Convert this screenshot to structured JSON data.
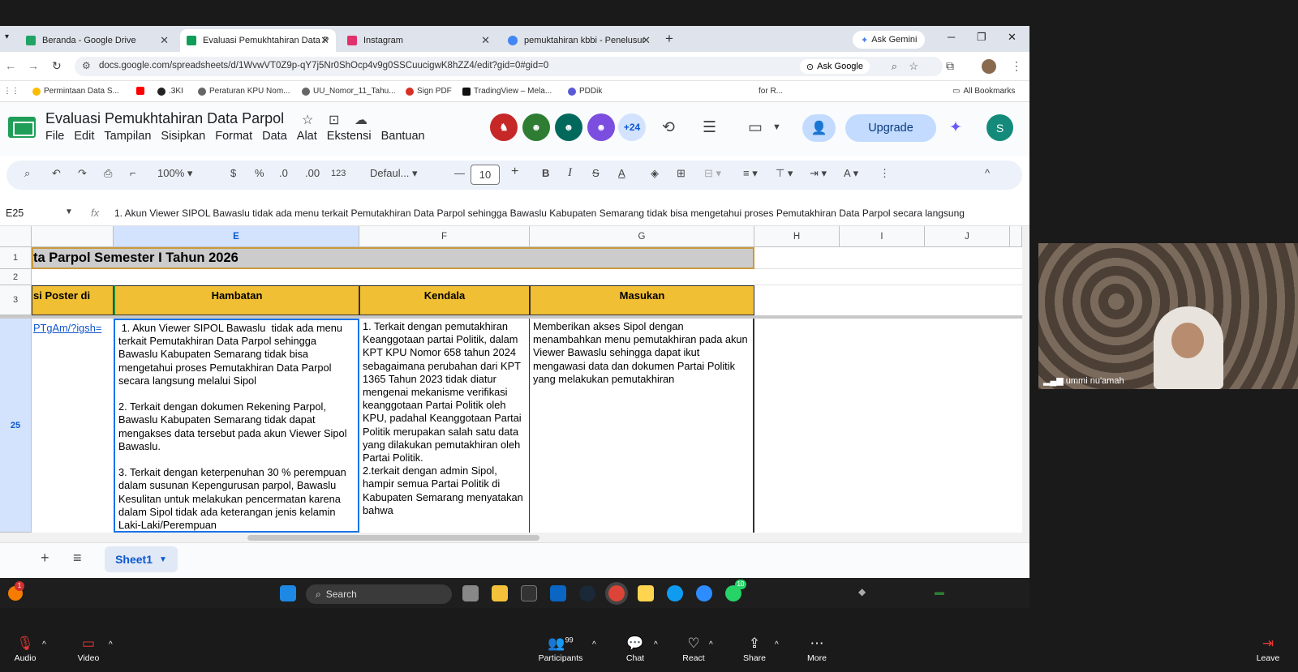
{
  "browser": {
    "tabs": [
      {
        "label": "Beranda - Google Drive",
        "color": "#1fa463"
      },
      {
        "label": "Evaluasi Pemukhtahiran Data P",
        "color": "#0f9d58"
      },
      {
        "label": "Instagram",
        "color": "#e1306c"
      },
      {
        "label": "pemuktahiran kbbi - Penelusur",
        "color": "#4285f4"
      }
    ],
    "ask_gemini": "Ask Gemini",
    "url": "docs.google.com/spreadsheets/d/1WvwVT0Z9p-qY7j5Nr0ShOcp4v9g0SSCuucigwK8hZZ4/edit?gid=0#gid=0",
    "ask_google": "Ask Google",
    "bookmarks": [
      "Permintaan Data S...",
      ".3KI",
      "Peraturan KPU Nom...",
      "UU_Nomor_11_Tahu...",
      "Sign PDF",
      "TradingView – Mela...",
      "PDDik",
      "for R..."
    ],
    "all_bookmarks": "All Bookmarks"
  },
  "sheets": {
    "title": "Evaluasi Pemukhtahiran Data Parpol",
    "menu": [
      "File",
      "Edit",
      "Tampilan",
      "Sisipkan",
      "Format",
      "Data",
      "Alat",
      "Ekstensi",
      "Bantuan"
    ],
    "collab_count": "+24",
    "upgrade": "Upgrade",
    "profile_initial": "S",
    "toolbar": {
      "zoom": "100%",
      "currency": "$",
      "percent": "%",
      "dec_minus": ".0",
      "dec_plus": ".00",
      "format123": "123",
      "font": "Defaul...",
      "font_size": "10"
    },
    "namebox": "E25",
    "fx": "fx",
    "formula": "1. Akun Viewer SIPOL Bawaslu  tidak ada menu terkait Pemutakhiran Data Parpol sehingga Bawaslu Kabupaten Semarang tidak bisa mengetahui proses Pemutakhiran Data Parpol secara langsung",
    "columns": [
      "E",
      "F",
      "G",
      "H",
      "I",
      "J"
    ],
    "rows": [
      "1",
      "2",
      "3",
      "25"
    ],
    "cells": {
      "r1_title": "ta Parpol Semester I Tahun 2026",
      "d3": "si Poster di",
      "e3": "Hambatan",
      "f3": "Kendala",
      "g3": "Masukan",
      "d25": "PTgAm/?igsh=",
      "e25": " 1. Akun Viewer SIPOL Bawaslu  tidak ada menu terkait Pemutakhiran Data Parpol sehingga Bawaslu Kabupaten Semarang tidak bisa mengetahui proses Pemutakhiran Data Parpol secara langsung melalui Sipol\n\n2. Terkait dengan dokumen Rekening Parpol, Bawaslu Kabupaten Semarang tidak dapat mengakses data tersebut pada akun Viewer Sipol Bawaslu.\n\n3. Terkait dengan keterpenuhan 30 % perempuan dalam susunan Kepengurusan parpol, Bawaslu Kesulitan untuk melakukan pencermatan karena dalam Sipol tidak ada keterangan jenis kelamin Laki-Laki/Perempuan",
      "f25": "1. Terkait dengan pemutakhiran Keanggotaan partai Politik, dalam KPT KPU Nomor 658 tahun 2024 sebagaimana perubahan dari KPT 1365 Tahun 2023 tidak diatur mengenai mekanisme verifikasi keanggotaan Partai Politik oleh KPU, padahal Keanggotaan Partai Politik merupakan salah satu data yang dilakukan pemutakhiran oleh Partai Politik.\n2.terkait dengan admin Sipol, hampir semua Partai Politik di Kabupaten Semarang menyatakan bahwa",
      "g25": "Memberikan akses Sipol dengan menambahkan menu pemutakhiran pada akun Viewer Bawaslu sehingga dapat ikut mengawasi data dan dokumen Partai Politik yang melakukan pemutakhiran"
    },
    "sheet_tab": "Sheet1"
  },
  "taskbar": {
    "search": "Search",
    "notif_count": "1",
    "whatsapp_badge": "10"
  },
  "video": {
    "participant": "ummi nu'amah"
  },
  "zoom": {
    "audio": "Audio",
    "video": "Video",
    "participants": "Participants",
    "participants_count": "99",
    "chat": "Chat",
    "react": "React",
    "share": "Share",
    "more": "More",
    "leave": "Leave"
  }
}
